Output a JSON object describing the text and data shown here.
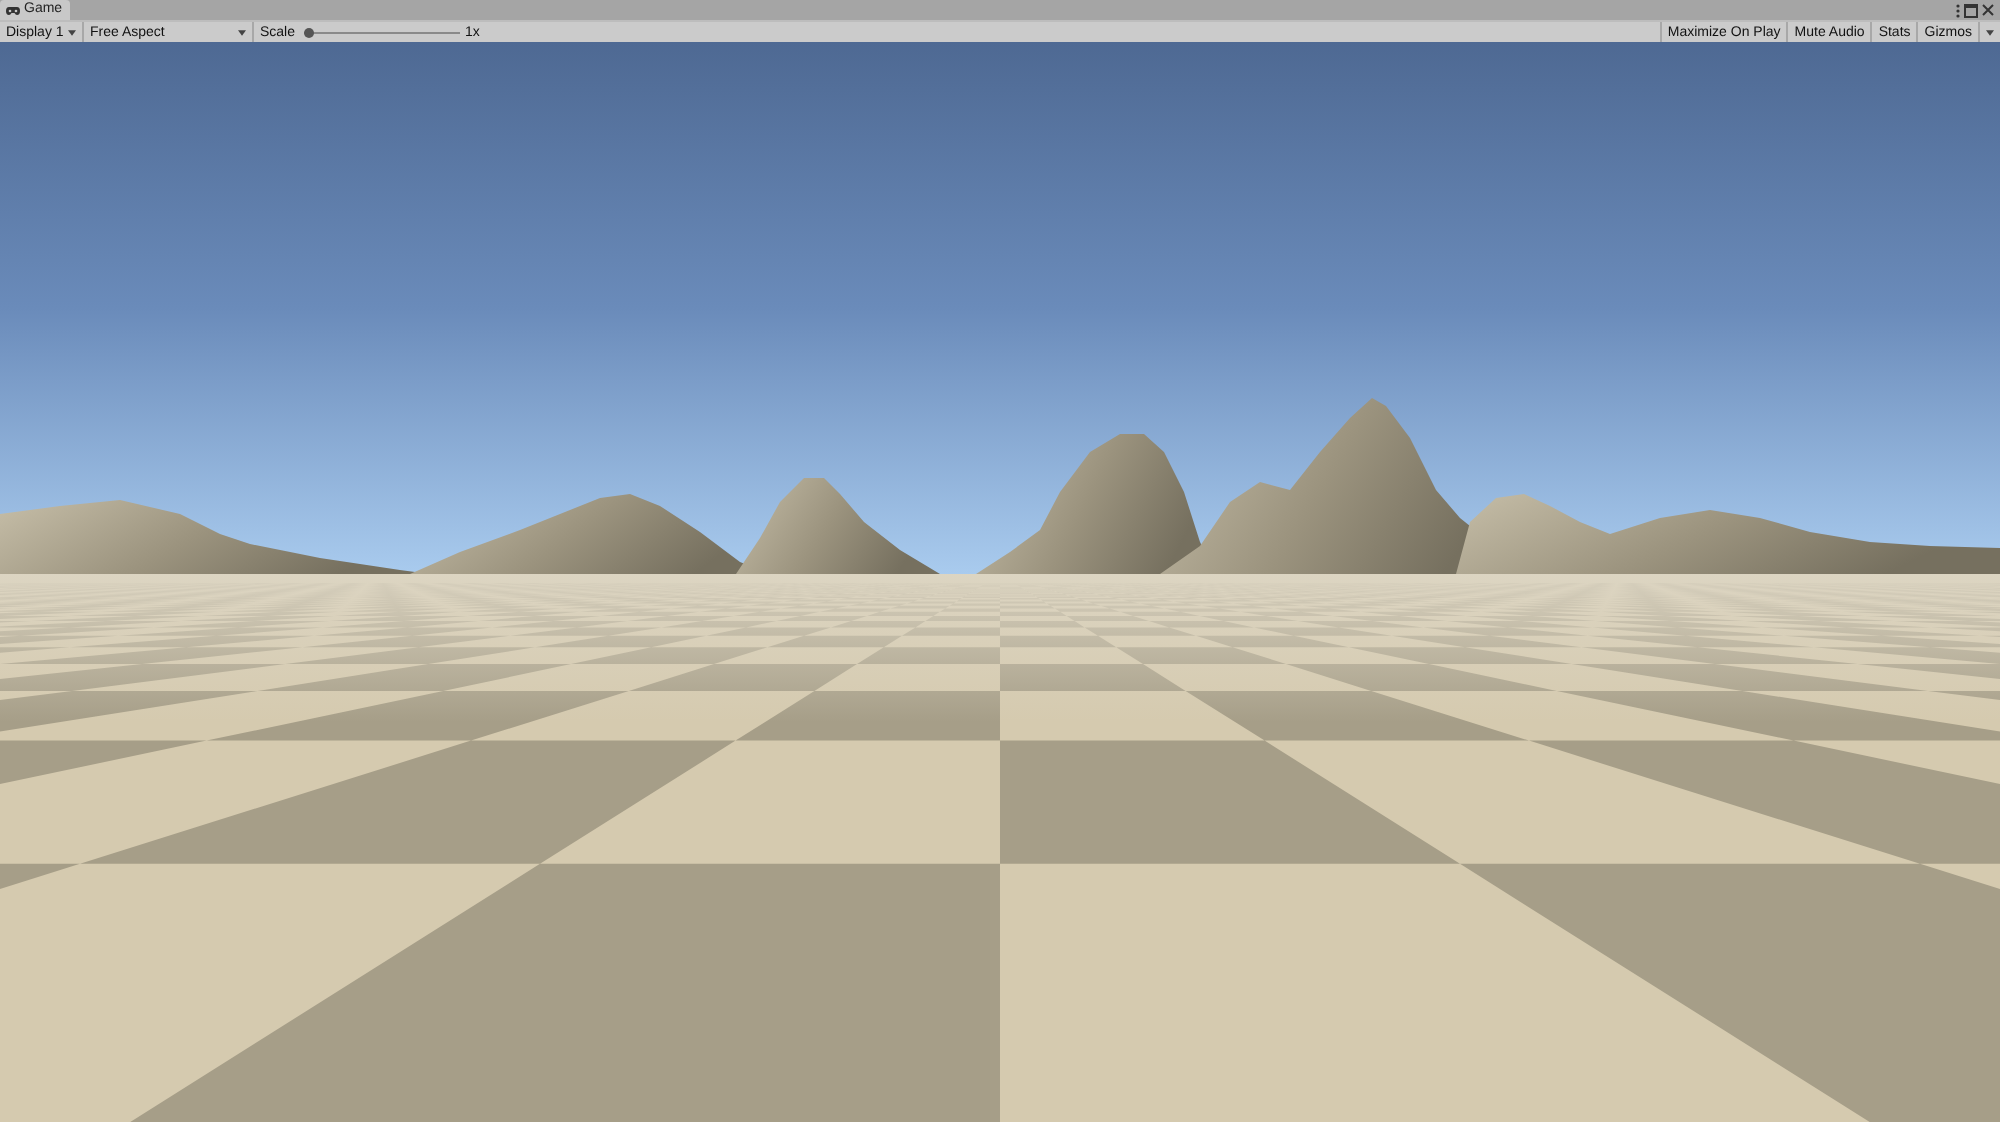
{
  "tab": {
    "label": "Game",
    "selected": true
  },
  "toolbar": {
    "display": {
      "value": "Display 1"
    },
    "aspect": {
      "value": "Free Aspect"
    },
    "scale": {
      "label": "Scale",
      "level": 0,
      "reading": "1x"
    },
    "buttons": [
      {
        "label": "Maximize On Play",
        "kind": "toggle"
      },
      {
        "label": "Mute Audio",
        "kind": "toggle"
      },
      {
        "label": "Stats",
        "kind": "toggle"
      },
      {
        "label": "Gizmos",
        "kind": "split"
      }
    ]
  }
}
